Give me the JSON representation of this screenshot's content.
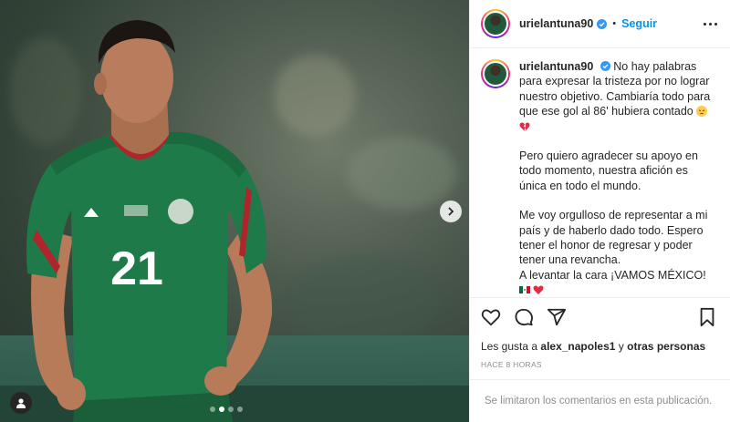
{
  "post": {
    "username": "urielantuna90",
    "verified": true,
    "follow_label": "Seguir",
    "caption": {
      "username": "urielantuna90",
      "paragraph1": "No hay palabras para expresar la tristeza por no lograr nuestro objetivo. Cambiaría todo para que ese gol al 86' hubiera contado",
      "paragraph2": "Pero quiero agradecer su apoyo en todo momento, nuestra afición es única en todo el mundo.",
      "paragraph3": "Me voy orgulloso de representar a mi país y de haberlo dado todo. Espero tener el honor de regresar y poder tener una revancha.",
      "paragraph4": "A levantar la cara ¡VAMOS MÉXICO!"
    },
    "likes": {
      "prefix": "Les gusta a",
      "user": "alex_napoles1",
      "connector": "y",
      "others": "otras personas"
    },
    "time_ago": "HACE 8 HORAS",
    "comments_disabled": "Se limitaron los comentarios en esta publicación.",
    "media": {
      "jersey_number": "21",
      "carousel_index": 2,
      "carousel_total": 4
    }
  },
  "icons": {
    "like": "heart-icon",
    "comment": "comment-icon",
    "share": "share-icon",
    "save": "bookmark-icon",
    "more": "more-options-icon",
    "next": "chevron-right-icon",
    "tag": "user-tag-icon"
  },
  "colors": {
    "link": "#0095f6",
    "verified": "#3897f0",
    "muted": "#8e8e8e",
    "jersey": "#1f7a4a"
  }
}
